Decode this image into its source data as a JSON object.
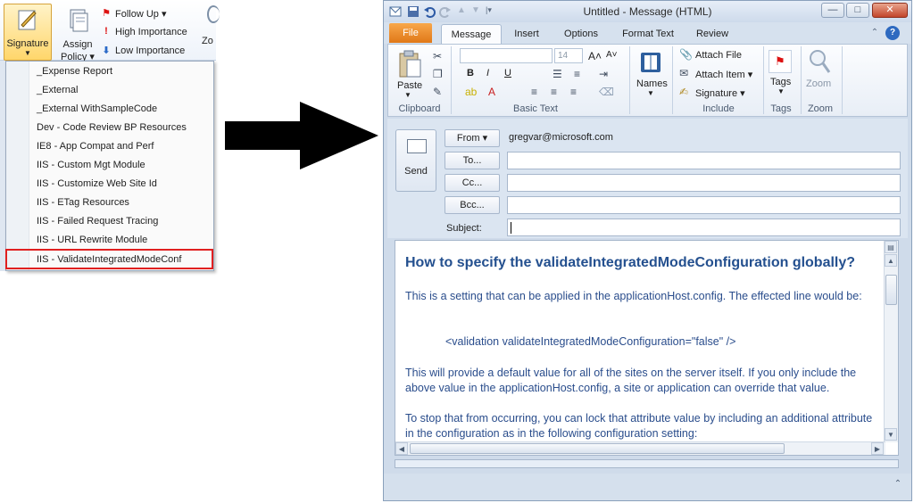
{
  "left_ribbon": {
    "signature_label": "Signature",
    "assign_policy_line1": "Assign",
    "assign_policy_line2": "Policy ▾",
    "follow_up": "Follow Up ▾",
    "high_importance": "High Importance",
    "low_importance": "Low Importance",
    "zoom_fragment": "Zo"
  },
  "signature_menu": {
    "items": [
      "_Expense Report",
      "_External",
      "_External WithSampleCode",
      "Dev - Code Review BP Resources",
      "IE8 - App Compat and Perf",
      "IIS - Custom Mgt Module",
      "IIS - Customize Web Site Id",
      "IIS - ETag Resources",
      "IIS - Failed Request Tracing",
      "IIS - URL Rewrite Module",
      "IIS - ValidateIntegratedModeConf"
    ],
    "highlighted_index": 10
  },
  "window": {
    "title": "Untitled  -  Message (HTML)",
    "controls": {
      "minimize": "—",
      "maximize": "□",
      "close": "✕"
    }
  },
  "ribbon_tabs": {
    "file": "File",
    "message": "Message",
    "insert": "Insert",
    "options": "Options",
    "format_text": "Format Text",
    "review": "Review",
    "help_glyph": "?"
  },
  "ribbon": {
    "paste": "Paste",
    "clipboard": "Clipboard",
    "font_size": "14",
    "basic_text": "Basic Text",
    "names": "Names",
    "attach_file": "Attach File",
    "attach_item": "Attach Item ▾",
    "signature": "Signature ▾",
    "include": "Include",
    "tags": "Tags",
    "tags_group": "Tags",
    "zoom_button": "Zoom",
    "zoom_group": "Zoom",
    "bold": "B",
    "italic": "I",
    "underline": "U",
    "grow_font": "A˄",
    "shrink_font": "A˅"
  },
  "compose": {
    "send": "Send",
    "from_button": "From ▾",
    "from_address": "gregvar@microsoft.com",
    "to_button": "To...",
    "cc_button": "Cc...",
    "bcc_button": "Bcc...",
    "subject_label": "Subject:",
    "to_value": "",
    "cc_value": "",
    "bcc_value": "",
    "subject_value": ""
  },
  "body": {
    "heading": "How to specify the validateIntegratedModeConfiguration globally?",
    "para1": "This is a setting that can be applied in the applicationHost.config.  The effected line would be:",
    "code": "<validation validateIntegratedModeConfiguration=\"false\" />",
    "para2": "This will provide a default value for all of the sites on the server itself.  If you only include the above value in the applicationHost.config, a site or application can override that value.",
    "para3": "To stop that from occurring, you can lock that attribute value by including an additional attribute in the configuration as in the following configuration setting:"
  },
  "colors": {
    "menu_highlight_border": "#e02020",
    "file_tab": "#e07818",
    "body_text": "#2a4d8c",
    "heading_text": "#24508f"
  },
  "icons": [
    "signature-icon",
    "assign-policy-icon",
    "follow-up-flag-icon",
    "high-importance-icon",
    "low-importance-icon",
    "save-icon",
    "undo-icon",
    "redo-icon",
    "paste-icon",
    "names-icon",
    "attach-file-icon",
    "tags-flag-icon",
    "zoom-icon",
    "send-icon"
  ]
}
